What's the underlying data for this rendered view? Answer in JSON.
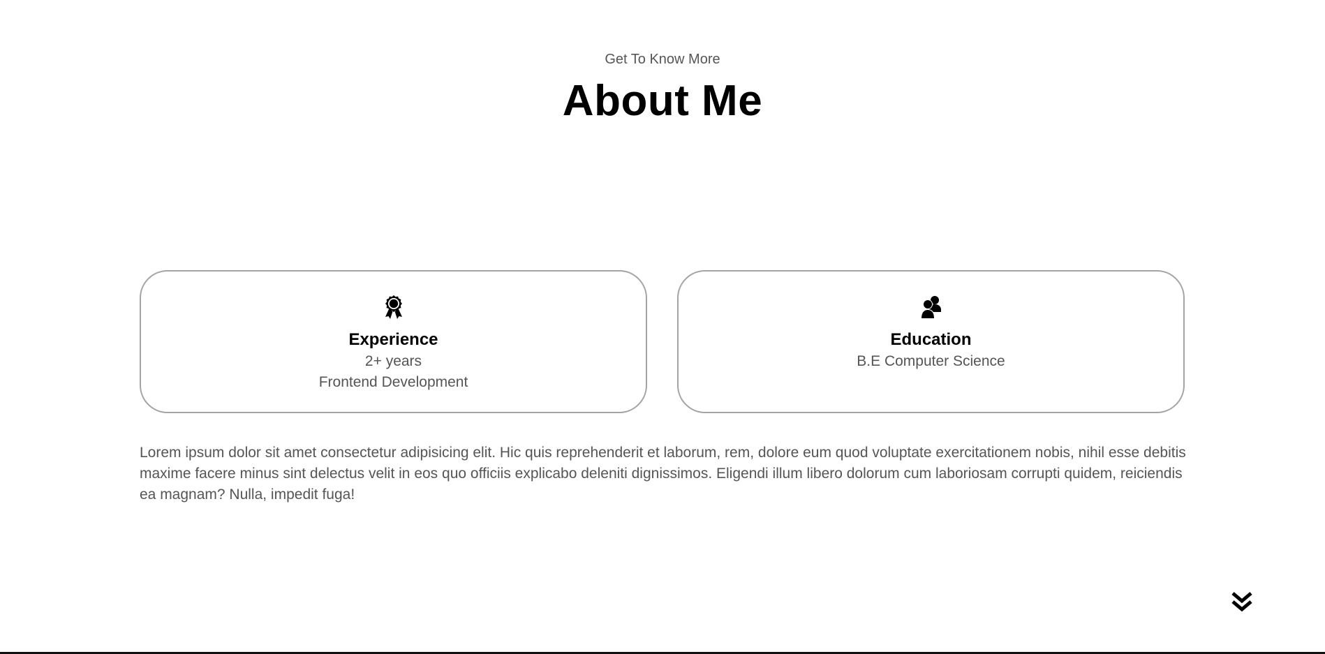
{
  "header": {
    "subtitle": "Get To Know More",
    "title": "About Me"
  },
  "cards": {
    "experience": {
      "icon": "award-icon",
      "title": "Experience",
      "line1": "2+ years",
      "line2": "Frontend Development"
    },
    "education": {
      "icon": "users-icon",
      "title": "Education",
      "line1": "B.E Computer Science"
    }
  },
  "body": {
    "text": "Lorem ipsum dolor sit amet consectetur adipisicing elit. Hic quis reprehenderit et laborum, rem, dolore eum quod voluptate exercitationem nobis, nihil esse debitis maxime facere minus sint delectus velit in eos quo officiis explicabo deleniti dignissimos. Eligendi illum libero dolorum cum laboriosam corrupti quidem, reiciendis ea magnam? Nulla, impedit fuga!"
  },
  "navigation": {
    "scroll_icon": "double-chevron-down-icon"
  },
  "colors": {
    "background": "#ffffff",
    "text_primary": "#000000",
    "text_secondary": "#555555",
    "card_border": "#a3a3a3"
  }
}
